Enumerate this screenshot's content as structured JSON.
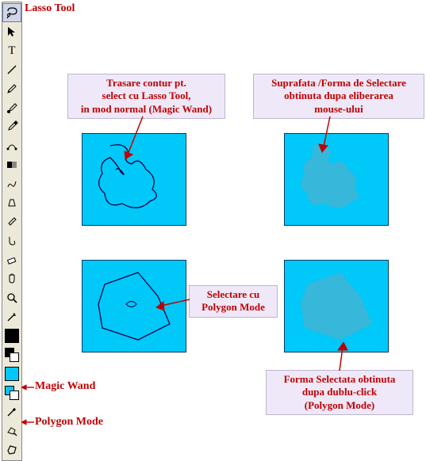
{
  "labels": {
    "lasso_tool": "Lasso Tool",
    "magic_wand": "Magic Wand",
    "polygon_mode": "Polygon Mode"
  },
  "callouts": {
    "top_left_l1": "Trasare contur pt.",
    "top_left_l2": "select cu Lasso Tool,",
    "top_left_l3": "in mod normal (Magic Wand)",
    "top_right_l1": "Suprafata /Forma de Selectare",
    "top_right_l2": "obtinuta dupa eliberarea",
    "top_right_l3": "mouse-ului",
    "mid_l1": "Selectare cu",
    "mid_l2": "Polygon Mode",
    "bot_right_l1": "Forma Selectata obtinuta",
    "bot_right_l2": "dupa dublu-click",
    "bot_right_l3": "(Polygon Mode)"
  },
  "tools": {
    "lasso": "lasso-icon",
    "arrow": "arrow-icon",
    "text": "text-icon",
    "line": "line-icon",
    "pencil": "pencil-icon",
    "brush": "brush-icon",
    "eyedrop": "eyedropper-icon",
    "bezier": "bezier-icon",
    "gradient": "gradient-icon",
    "freehand": "freehand-icon",
    "perspective": "perspective-icon",
    "eyedrop2": "eyedropper2-icon",
    "smudge": "smudge-icon",
    "eraser": "eraser-icon",
    "hand": "hand-icon",
    "zoom": "zoom-icon",
    "t2": "wand-extra-icon",
    "magicwand": "magic-wand-icon",
    "polybrush": "poly-brush-icon",
    "polygonmode": "polygon-mode-icon"
  }
}
